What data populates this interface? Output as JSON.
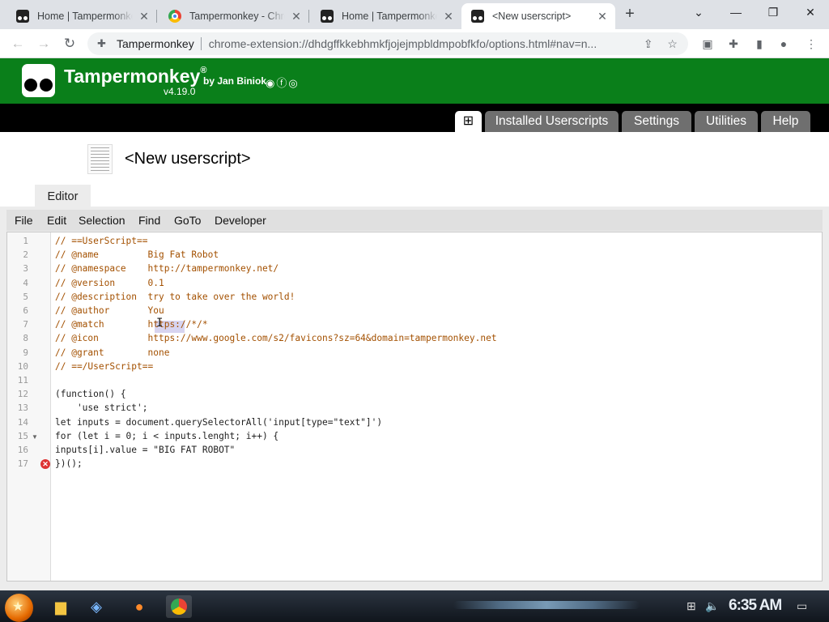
{
  "browser": {
    "tabs": [
      {
        "title": "Home | Tampermonkey"
      },
      {
        "title": "Tampermonkey - Chrome Web Store"
      },
      {
        "title": "Home | Tampermonkey"
      },
      {
        "title": "<New userscript>"
      }
    ],
    "site_label": "Tampermonkey",
    "url": "chrome-extension://dhdgffkkebhmkfjojejmpbldmpobfkfo/options.html#nav=n...",
    "window_controls": {
      "minimize": "—",
      "restore": "❐",
      "close": "✕",
      "tablist": "⌄"
    }
  },
  "tm_header": {
    "title": "Tampermonkey",
    "registered": "®",
    "by": "by Jan Biniok",
    "version": "v4.19.0"
  },
  "tm_nav": {
    "add_icon": "⊞",
    "tabs": [
      "Installed Userscripts",
      "Settings",
      "Utilities",
      "Help"
    ]
  },
  "script": {
    "title": "<New userscript>",
    "editor_tab": "Editor"
  },
  "editor": {
    "menu": [
      "File",
      "Edit",
      "Selection",
      "Find",
      "GoTo",
      "Developer"
    ],
    "lines": [
      {
        "n": "1",
        "text": "// ==UserScript=="
      },
      {
        "n": "2",
        "text": "// @name         Big Fat Robot"
      },
      {
        "n": "3",
        "text": "// @namespace    http://tampermonkey.net/"
      },
      {
        "n": "4",
        "text": "// @version      0.1"
      },
      {
        "n": "5",
        "text": "// @description  try to take over the world!"
      },
      {
        "n": "6",
        "text": "// @author       You"
      },
      {
        "n": "7",
        "text": "// @match        https://*/*"
      },
      {
        "n": "8",
        "text": "// @icon         https://www.google.com/s2/favicons?sz=64&domain=tampermonkey.net"
      },
      {
        "n": "9",
        "text": "// @grant        none"
      },
      {
        "n": "10",
        "text": "// ==/UserScript=="
      },
      {
        "n": "11",
        "text": ""
      },
      {
        "n": "12",
        "text": "(function() {"
      },
      {
        "n": "13",
        "text": "    'use strict';"
      },
      {
        "n": "14",
        "text": "let inputs = document.querySelectorAll('input[type=\"text\"]')"
      },
      {
        "n": "15",
        "text": "for (let i = 0; i < inputs.lenght; i++) {"
      },
      {
        "n": "16",
        "text": "inputs[i].value = \"BIG FAT ROBOT\""
      },
      {
        "n": "17",
        "text": "})();"
      }
    ],
    "error_line": "17",
    "fold_line": "15"
  },
  "taskbar": {
    "clock": "6:35 AM"
  }
}
